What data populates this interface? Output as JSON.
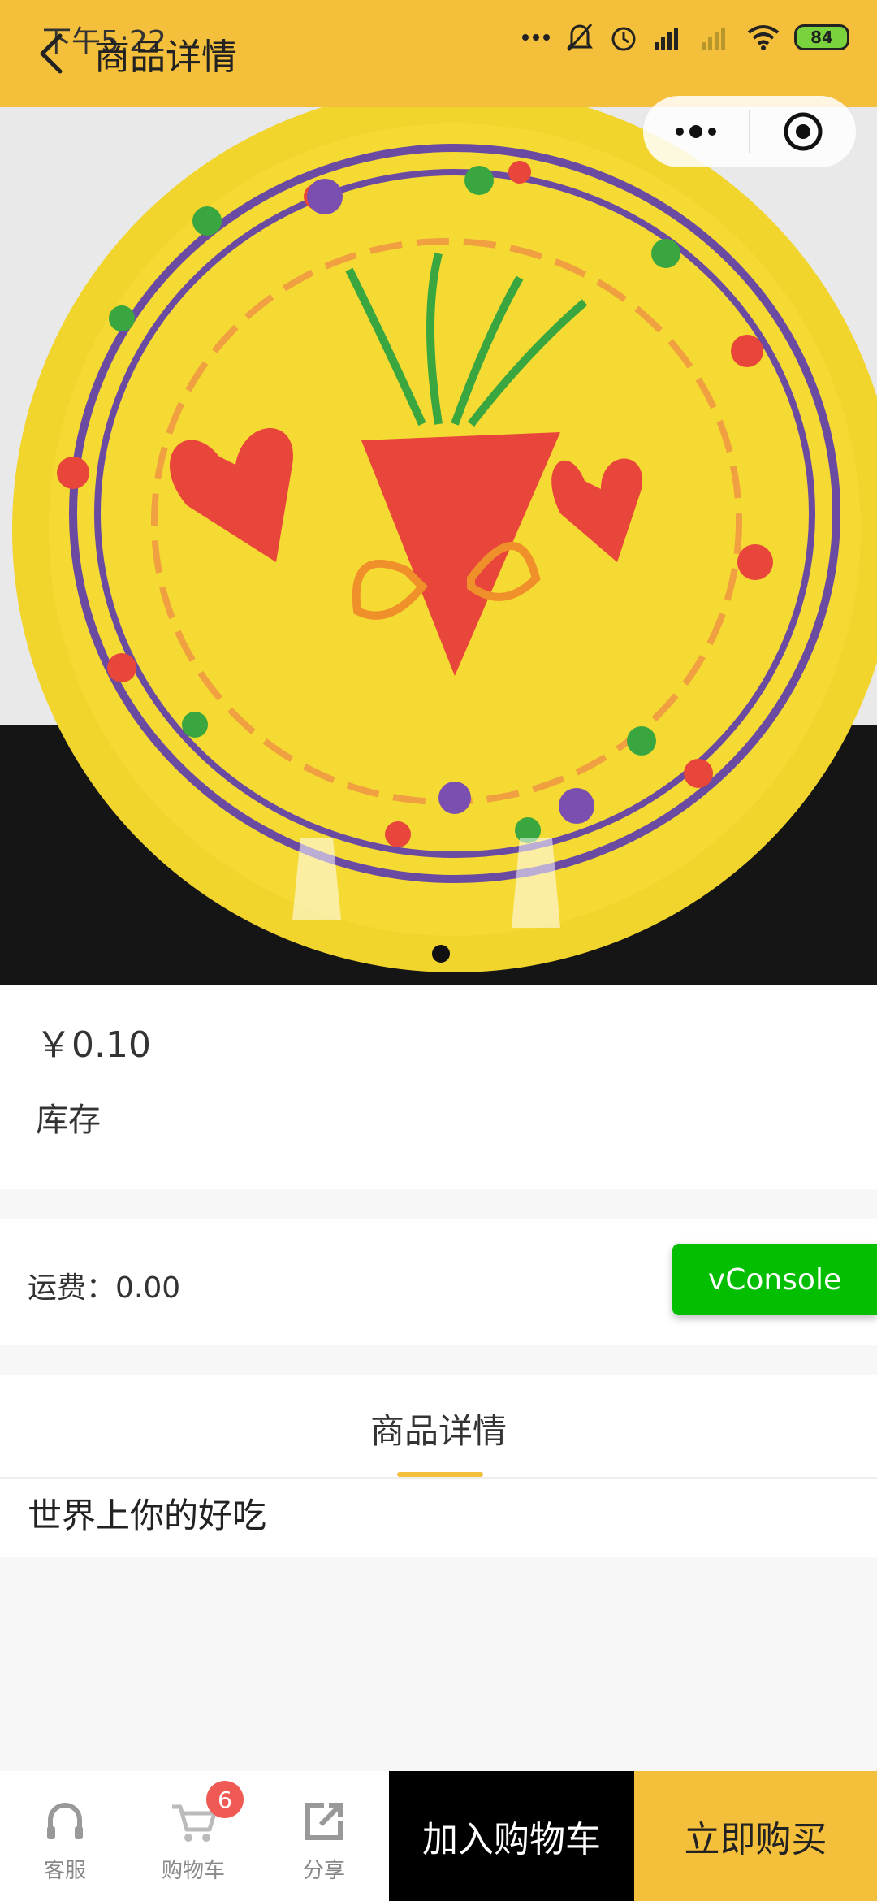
{
  "status_bar": {
    "time": "下午5:22",
    "battery": "84",
    "icons": [
      "more-dots-icon",
      "mute-icon",
      "alarm-icon",
      "signal-icon",
      "signal-weak-icon",
      "wifi-icon",
      "battery-icon"
    ]
  },
  "nav": {
    "title": "商品详情"
  },
  "product": {
    "price": "￥0.10",
    "stock_label": "库存",
    "shipping": "运费：0.00",
    "description": "世界上你的好吃"
  },
  "debug": {
    "vconsole_label": "vConsole"
  },
  "tabs": {
    "detail_label": "商品详情"
  },
  "bottom_bar": {
    "service_label": "客服",
    "cart_label": "购物车",
    "cart_count": "6",
    "share_label": "分享",
    "add_to_cart_label": "加入购物车",
    "buy_now_label": "立即购买"
  },
  "colors": {
    "brand": "#f4bf3a",
    "add_to_cart_bg": "#000000",
    "vconsole_bg": "#04be02",
    "badge": "#f05a54"
  }
}
